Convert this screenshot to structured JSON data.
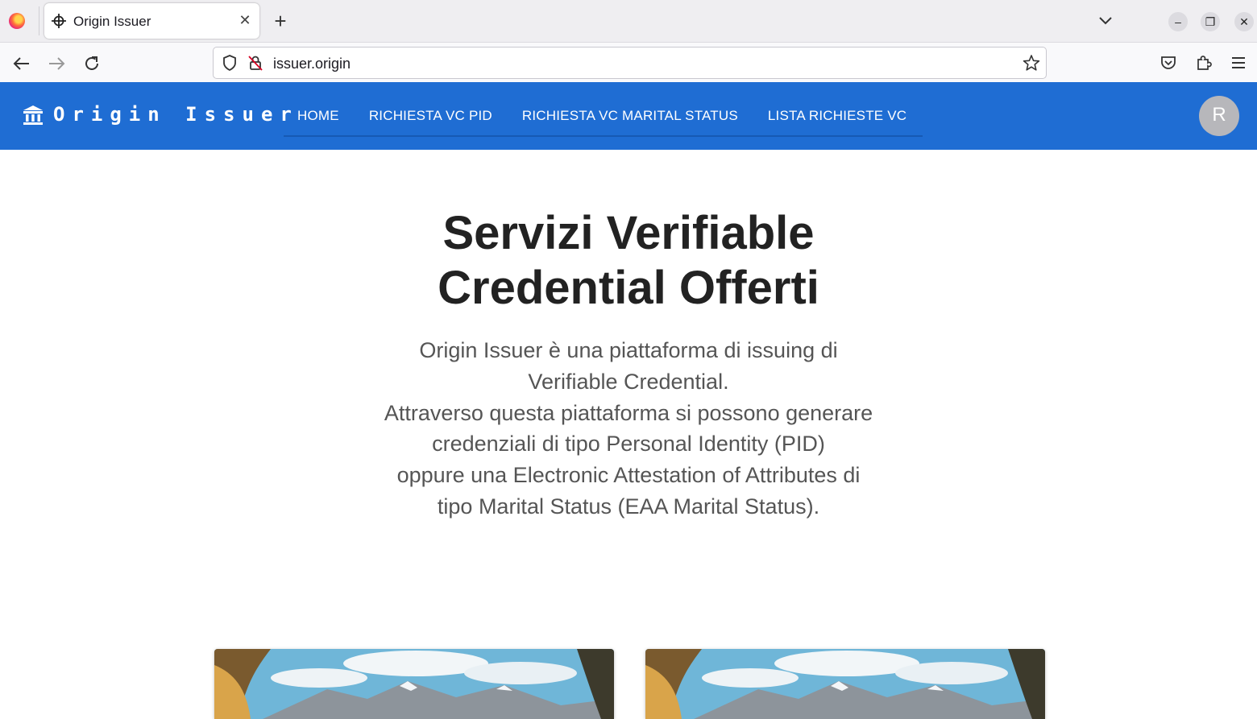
{
  "browser": {
    "tab_title": "Origin Issuer",
    "url": "issuer.origin",
    "icons": {
      "browser_logo": "firefox-icon",
      "tab_favicon": "crosshair-icon",
      "tab_close": "close-icon",
      "new_tab": "plus-icon",
      "tab_list": "chevron-down-icon",
      "back": "arrow-left-icon",
      "forward": "arrow-right-icon",
      "reload": "reload-icon",
      "tracking": "shield-icon",
      "insecure": "lock-slash-icon",
      "bookmark": "star-icon",
      "pocket": "pocket-icon",
      "extensions": "puzzle-icon",
      "menu": "hamburger-icon"
    }
  },
  "header": {
    "brand": "Origin Issuer",
    "brand_icon": "bank-icon",
    "nav": [
      {
        "label": "HOME"
      },
      {
        "label": "RICHIESTA VC PID"
      },
      {
        "label": "RICHIESTA VC MARITAL STATUS"
      },
      {
        "label": "LISTA RICHIESTE VC"
      }
    ],
    "avatar_initial": "R"
  },
  "hero": {
    "title": "Servizi Verifiable Credential Offerti",
    "lines": [
      "Origin Issuer è una piattaforma di issuing di",
      "Verifiable Credential.",
      "Attraverso questa piattaforma si possono generare",
      "credenziali di tipo Personal Identity (PID)",
      "oppure una Electronic Attestation of Attributes di",
      "tipo Marital Status (EAA Marital Status)."
    ]
  },
  "colors": {
    "header_bg": "#1f6dd3",
    "title_text": "#222222",
    "body_text": "#555555"
  }
}
